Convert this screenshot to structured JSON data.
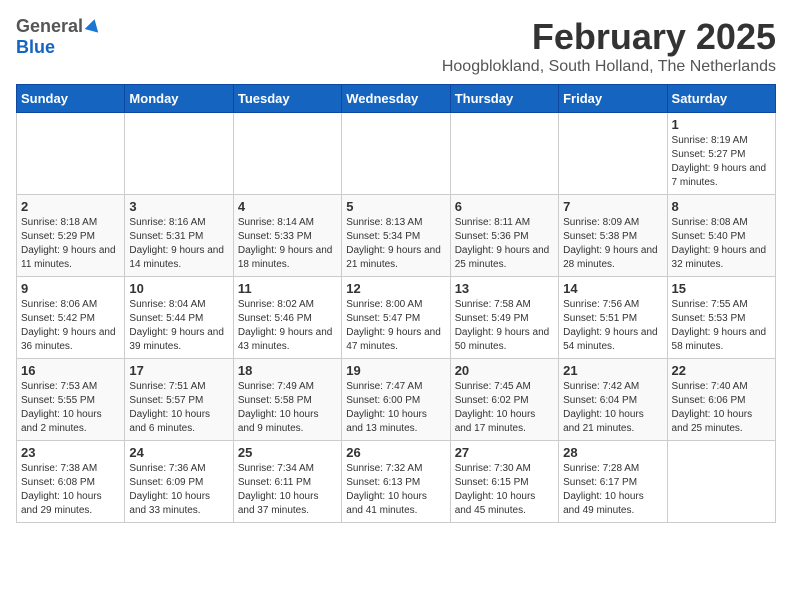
{
  "header": {
    "logo_general": "General",
    "logo_blue": "Blue",
    "month_title": "February 2025",
    "location": "Hoogblokland, South Holland, The Netherlands"
  },
  "weekdays": [
    "Sunday",
    "Monday",
    "Tuesday",
    "Wednesday",
    "Thursday",
    "Friday",
    "Saturday"
  ],
  "weeks": [
    [
      {
        "day": "",
        "info": ""
      },
      {
        "day": "",
        "info": ""
      },
      {
        "day": "",
        "info": ""
      },
      {
        "day": "",
        "info": ""
      },
      {
        "day": "",
        "info": ""
      },
      {
        "day": "",
        "info": ""
      },
      {
        "day": "1",
        "info": "Sunrise: 8:19 AM\nSunset: 5:27 PM\nDaylight: 9 hours and 7 minutes."
      }
    ],
    [
      {
        "day": "2",
        "info": "Sunrise: 8:18 AM\nSunset: 5:29 PM\nDaylight: 9 hours and 11 minutes."
      },
      {
        "day": "3",
        "info": "Sunrise: 8:16 AM\nSunset: 5:31 PM\nDaylight: 9 hours and 14 minutes."
      },
      {
        "day": "4",
        "info": "Sunrise: 8:14 AM\nSunset: 5:33 PM\nDaylight: 9 hours and 18 minutes."
      },
      {
        "day": "5",
        "info": "Sunrise: 8:13 AM\nSunset: 5:34 PM\nDaylight: 9 hours and 21 minutes."
      },
      {
        "day": "6",
        "info": "Sunrise: 8:11 AM\nSunset: 5:36 PM\nDaylight: 9 hours and 25 minutes."
      },
      {
        "day": "7",
        "info": "Sunrise: 8:09 AM\nSunset: 5:38 PM\nDaylight: 9 hours and 28 minutes."
      },
      {
        "day": "8",
        "info": "Sunrise: 8:08 AM\nSunset: 5:40 PM\nDaylight: 9 hours and 32 minutes."
      }
    ],
    [
      {
        "day": "9",
        "info": "Sunrise: 8:06 AM\nSunset: 5:42 PM\nDaylight: 9 hours and 36 minutes."
      },
      {
        "day": "10",
        "info": "Sunrise: 8:04 AM\nSunset: 5:44 PM\nDaylight: 9 hours and 39 minutes."
      },
      {
        "day": "11",
        "info": "Sunrise: 8:02 AM\nSunset: 5:46 PM\nDaylight: 9 hours and 43 minutes."
      },
      {
        "day": "12",
        "info": "Sunrise: 8:00 AM\nSunset: 5:47 PM\nDaylight: 9 hours and 47 minutes."
      },
      {
        "day": "13",
        "info": "Sunrise: 7:58 AM\nSunset: 5:49 PM\nDaylight: 9 hours and 50 minutes."
      },
      {
        "day": "14",
        "info": "Sunrise: 7:56 AM\nSunset: 5:51 PM\nDaylight: 9 hours and 54 minutes."
      },
      {
        "day": "15",
        "info": "Sunrise: 7:55 AM\nSunset: 5:53 PM\nDaylight: 9 hours and 58 minutes."
      }
    ],
    [
      {
        "day": "16",
        "info": "Sunrise: 7:53 AM\nSunset: 5:55 PM\nDaylight: 10 hours and 2 minutes."
      },
      {
        "day": "17",
        "info": "Sunrise: 7:51 AM\nSunset: 5:57 PM\nDaylight: 10 hours and 6 minutes."
      },
      {
        "day": "18",
        "info": "Sunrise: 7:49 AM\nSunset: 5:58 PM\nDaylight: 10 hours and 9 minutes."
      },
      {
        "day": "19",
        "info": "Sunrise: 7:47 AM\nSunset: 6:00 PM\nDaylight: 10 hours and 13 minutes."
      },
      {
        "day": "20",
        "info": "Sunrise: 7:45 AM\nSunset: 6:02 PM\nDaylight: 10 hours and 17 minutes."
      },
      {
        "day": "21",
        "info": "Sunrise: 7:42 AM\nSunset: 6:04 PM\nDaylight: 10 hours and 21 minutes."
      },
      {
        "day": "22",
        "info": "Sunrise: 7:40 AM\nSunset: 6:06 PM\nDaylight: 10 hours and 25 minutes."
      }
    ],
    [
      {
        "day": "23",
        "info": "Sunrise: 7:38 AM\nSunset: 6:08 PM\nDaylight: 10 hours and 29 minutes."
      },
      {
        "day": "24",
        "info": "Sunrise: 7:36 AM\nSunset: 6:09 PM\nDaylight: 10 hours and 33 minutes."
      },
      {
        "day": "25",
        "info": "Sunrise: 7:34 AM\nSunset: 6:11 PM\nDaylight: 10 hours and 37 minutes."
      },
      {
        "day": "26",
        "info": "Sunrise: 7:32 AM\nSunset: 6:13 PM\nDaylight: 10 hours and 41 minutes."
      },
      {
        "day": "27",
        "info": "Sunrise: 7:30 AM\nSunset: 6:15 PM\nDaylight: 10 hours and 45 minutes."
      },
      {
        "day": "28",
        "info": "Sunrise: 7:28 AM\nSunset: 6:17 PM\nDaylight: 10 hours and 49 minutes."
      },
      {
        "day": "",
        "info": ""
      }
    ]
  ]
}
